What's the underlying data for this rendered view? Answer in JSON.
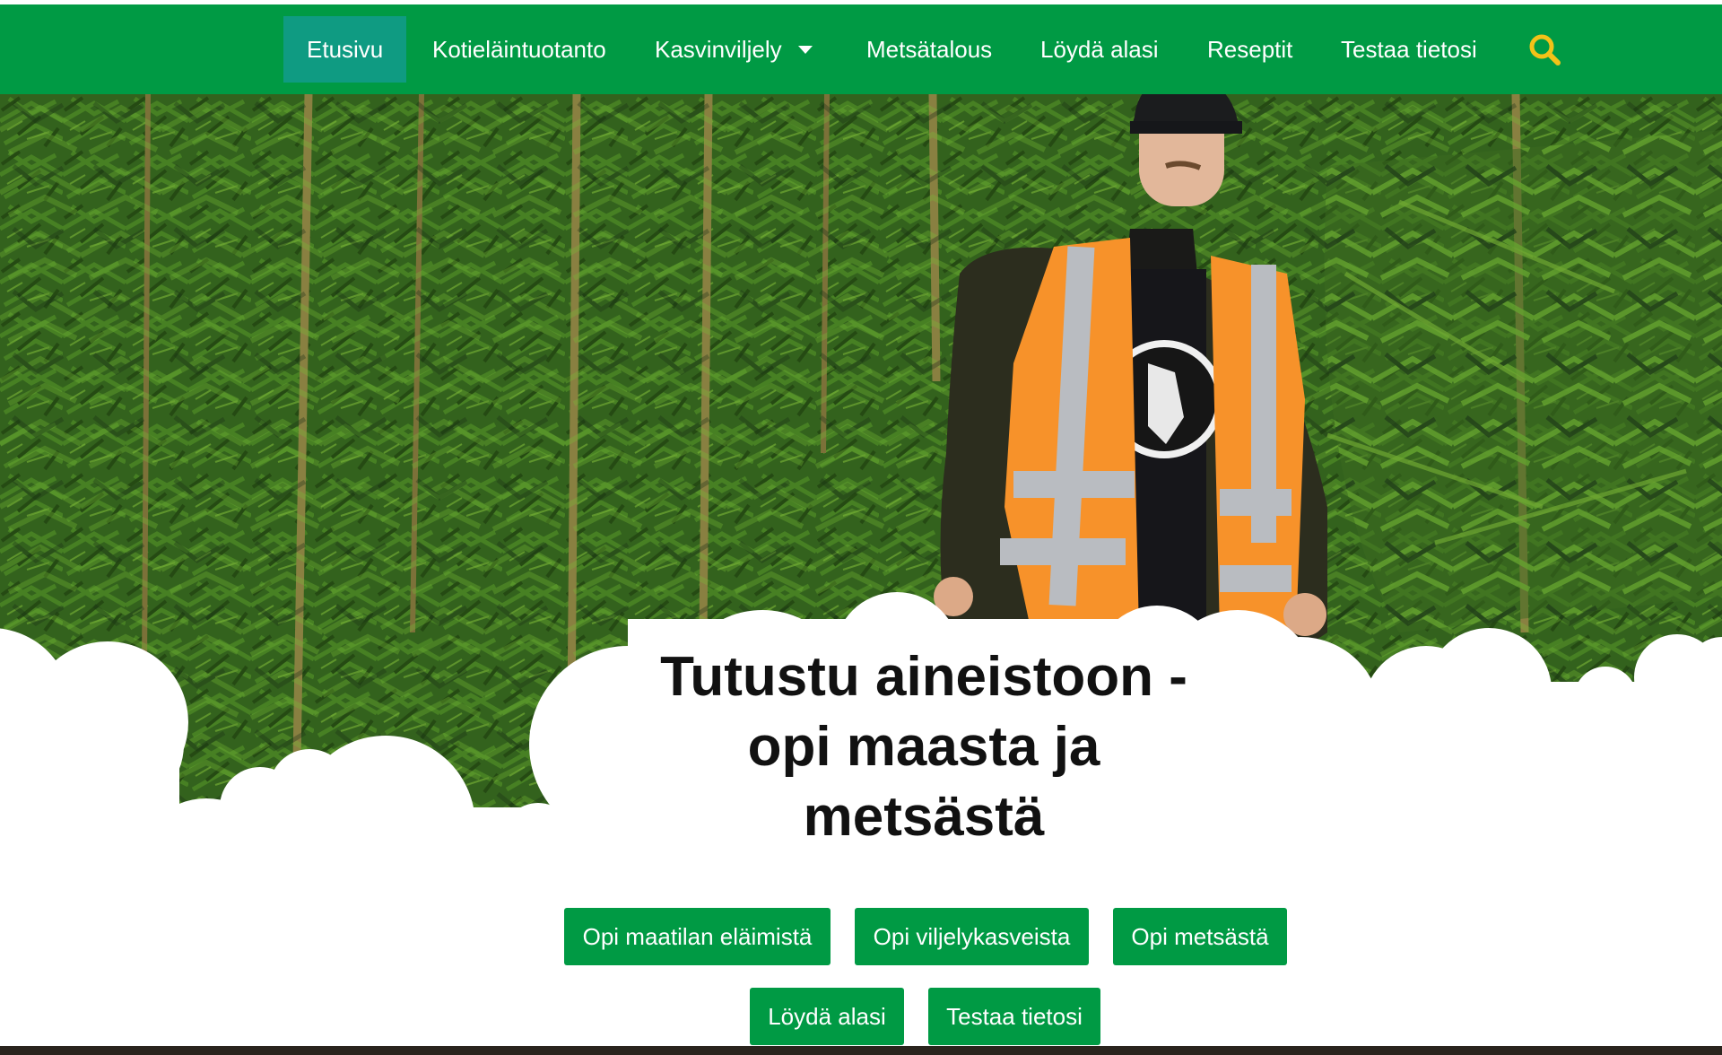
{
  "nav": {
    "items": [
      {
        "label": "Etusivu",
        "active": true
      },
      {
        "label": "Kotieläintuotanto"
      },
      {
        "label": "Kasvinviljely",
        "has_dropdown": true
      },
      {
        "label": "Metsätalous"
      },
      {
        "label": "Löydä alasi"
      },
      {
        "label": "Reseptit"
      },
      {
        "label": "Testaa tietosi"
      }
    ],
    "search_icon": "search-icon"
  },
  "hero": {
    "headline_lines": [
      "Tutustu aineistoon -",
      "opi maasta ja",
      "metsästä"
    ]
  },
  "cta_buttons": [
    {
      "label": "Opi maatilan eläimistä"
    },
    {
      "label": "Opi viljelykasveista"
    },
    {
      "label": "Opi metsästä"
    },
    {
      "label": "Löydä alasi"
    },
    {
      "label": "Testaa tietosi"
    }
  ],
  "colors": {
    "nav_green": "#009a44",
    "active_teal": "#0f9b82",
    "search_yellow": "#f2c218",
    "button_green": "#009a44",
    "vest_orange": "#f7922a"
  }
}
